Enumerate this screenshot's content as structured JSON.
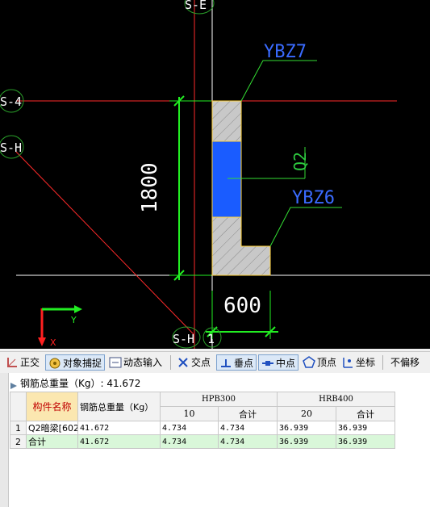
{
  "canvas": {
    "axis_labels": {
      "s_e": "S-E",
      "s_4": "S-4",
      "s_h_left": "S-H",
      "s_h_bottom": "S-H",
      "s_1": "1"
    },
    "component_labels": {
      "ybz7": "YBZ7",
      "ybz6": "YBZ6",
      "q2": "Q2"
    },
    "dimensions": {
      "vertical": "1800",
      "horizontal": "600"
    },
    "ucs": {
      "y_label": "Y",
      "x_label": "X"
    },
    "colors": {
      "background": "#000000",
      "axis_red": "#ff2a2a",
      "dimension_green": "#22ee22",
      "label_blue": "#3a6bff",
      "column_gray": "#c8c8c8",
      "wall_blue": "#1a5cff",
      "leader_green": "#33dd33"
    }
  },
  "toolbar": {
    "ortho": "正交",
    "snap": "对象捕捉",
    "dynamic_input": "动态输入",
    "intersection": "交点",
    "perpendicular": "垂点",
    "midpoint": "中点",
    "vertex": "顶点",
    "coordinate": "坐标",
    "no_offset": "不偏移"
  },
  "summary": {
    "total_weight": "钢筋总重量（Kg）: 41.672"
  },
  "table": {
    "headers": {
      "name": "构件名称",
      "total_weight": "钢筋总重量（Kg）",
      "hpb300": "HPB300",
      "hrb400": "HRB400",
      "hpb_10": "10",
      "hpb_total": "合计",
      "hrb_20": "20",
      "hrb_total": "合计"
    },
    "rows": [
      {
        "index": "1",
        "name": "Q2暗梁[602",
        "weight": "41.672",
        "hpb_10": "4.734",
        "hpb_total": "4.734",
        "hrb_20": "36.939",
        "hrb_total": "36.939"
      },
      {
        "index": "2",
        "name": "合计",
        "weight": "41.672",
        "hpb_10": "4.734",
        "hpb_total": "4.734",
        "hrb_20": "36.939",
        "hrb_total": "36.939"
      }
    ]
  }
}
